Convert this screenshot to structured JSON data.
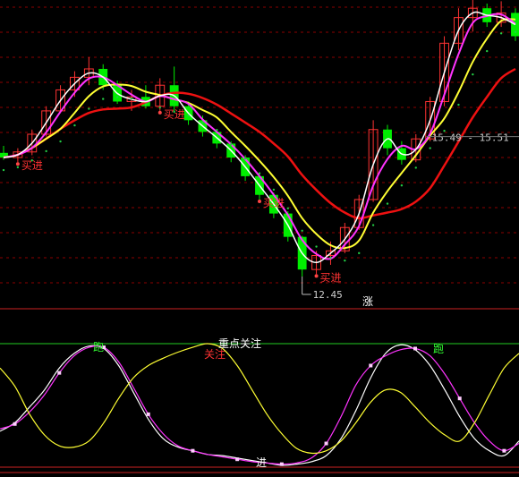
{
  "chart_data": [
    {
      "type": "candlestick",
      "price_markers": {
        "low_label": "12.45",
        "high_label": "15.49 - 15.51"
      },
      "signals": [
        {
          "text": "买进",
          "index": 1
        },
        {
          "text": "买进",
          "index": 11
        },
        {
          "text": "买进",
          "index": 18
        },
        {
          "text": "买进",
          "index": 22
        }
      ],
      "series_colors": {
        "up": "#ff3333",
        "down": "#00ee00",
        "ma_fast": "#ffffff",
        "ma_mid": "#ff33ff",
        "ma_slow": "#ffff33",
        "ma_long": "#ee1111",
        "dots": "#22cc44",
        "rect": "#33ddff"
      },
      "candles": [
        {
          "o": 15.1,
          "h": 15.25,
          "l": 14.95,
          "c": 15.0
        },
        {
          "o": 15.0,
          "h": 15.2,
          "l": 14.9,
          "c": 15.12
        },
        {
          "o": 15.12,
          "h": 15.6,
          "l": 15.05,
          "c": 15.5
        },
        {
          "o": 15.5,
          "h": 16.1,
          "l": 15.45,
          "c": 16.0
        },
        {
          "o": 16.0,
          "h": 16.55,
          "l": 15.95,
          "c": 16.45
        },
        {
          "o": 16.45,
          "h": 16.85,
          "l": 16.3,
          "c": 16.72
        },
        {
          "o": 16.72,
          "h": 17.15,
          "l": 16.55,
          "c": 16.9
        },
        {
          "o": 16.9,
          "h": 17.0,
          "l": 16.45,
          "c": 16.55
        },
        {
          "o": 16.55,
          "h": 16.65,
          "l": 16.15,
          "c": 16.2
        },
        {
          "o": 16.2,
          "h": 16.45,
          "l": 16.0,
          "c": 16.3
        },
        {
          "o": 16.3,
          "h": 16.55,
          "l": 16.05,
          "c": 16.1
        },
        {
          "o": 16.1,
          "h": 16.7,
          "l": 16.0,
          "c": 16.55
        },
        {
          "o": 16.55,
          "h": 16.95,
          "l": 16.0,
          "c": 16.1
        },
        {
          "o": 16.1,
          "h": 16.2,
          "l": 15.7,
          "c": 15.8
        },
        {
          "o": 15.8,
          "h": 15.9,
          "l": 15.45,
          "c": 15.55
        },
        {
          "o": 15.55,
          "h": 15.6,
          "l": 15.2,
          "c": 15.3
        },
        {
          "o": 15.3,
          "h": 15.35,
          "l": 14.9,
          "c": 15.0
        },
        {
          "o": 15.0,
          "h": 15.05,
          "l": 14.5,
          "c": 14.6
        },
        {
          "o": 14.6,
          "h": 14.65,
          "l": 14.1,
          "c": 14.2
        },
        {
          "o": 14.2,
          "h": 14.25,
          "l": 13.7,
          "c": 13.8
        },
        {
          "o": 13.8,
          "h": 13.85,
          "l": 13.2,
          "c": 13.3
        },
        {
          "o": 13.3,
          "h": 13.32,
          "l": 12.45,
          "c": 12.6
        },
        {
          "o": 12.6,
          "h": 13.0,
          "l": 12.5,
          "c": 12.9
        },
        {
          "o": 12.9,
          "h": 13.2,
          "l": 12.7,
          "c": 13.0
        },
        {
          "o": 13.0,
          "h": 13.6,
          "l": 12.95,
          "c": 13.5
        },
        {
          "o": 13.5,
          "h": 14.2,
          "l": 13.45,
          "c": 14.1
        },
        {
          "o": 14.1,
          "h": 15.8,
          "l": 14.05,
          "c": 15.6
        },
        {
          "o": 15.6,
          "h": 15.7,
          "l": 15.05,
          "c": 15.2
        },
        {
          "o": 15.2,
          "h": 15.35,
          "l": 14.85,
          "c": 14.95
        },
        {
          "o": 14.95,
          "h": 15.5,
          "l": 14.9,
          "c": 15.4
        },
        {
          "o": 15.4,
          "h": 16.3,
          "l": 15.35,
          "c": 16.2
        },
        {
          "o": 16.2,
          "h": 17.6,
          "l": 16.1,
          "c": 17.45
        },
        {
          "o": 17.45,
          "h": 18.2,
          "l": 17.3,
          "c": 18.0
        },
        {
          "o": 18.0,
          "h": 18.4,
          "l": 17.7,
          "c": 18.2
        },
        {
          "o": 18.2,
          "h": 18.3,
          "l": 17.8,
          "c": 17.9
        },
        {
          "o": 17.9,
          "h": 18.35,
          "l": 17.8,
          "c": 18.1
        },
        {
          "o": 18.1,
          "h": 18.2,
          "l": 17.5,
          "c": 17.6
        }
      ]
    },
    {
      "type": "line",
      "x_count": 36,
      "series": [
        {
          "color": "#ffffff",
          "values": [
            28,
            35,
            48,
            62,
            80,
            92,
            98,
            96,
            82,
            60,
            38,
            22,
            15,
            12,
            9,
            8,
            6,
            4,
            2,
            0,
            1,
            3,
            8,
            22,
            45,
            72,
            92,
            99,
            95,
            82,
            62,
            40,
            22,
            12,
            8,
            20
          ]
        },
        {
          "color": "#ff33ff",
          "values": [
            30,
            34,
            44,
            58,
            76,
            90,
            97,
            97,
            85,
            64,
            42,
            26,
            16,
            12,
            9,
            7,
            5,
            3,
            2,
            1,
            2,
            6,
            18,
            40,
            66,
            82,
            90,
            95,
            96,
            90,
            75,
            55,
            35,
            20,
            12,
            18
          ]
        },
        {
          "color": "#ffff33",
          "values": [
            80,
            65,
            42,
            25,
            16,
            15,
            20,
            35,
            55,
            72,
            82,
            88,
            93,
            97,
            100,
            96,
            82,
            62,
            42,
            26,
            14,
            10,
            12,
            20,
            35,
            52,
            62,
            60,
            48,
            35,
            25,
            20,
            35,
            58,
            80,
            92
          ]
        }
      ],
      "annotations": [
        {
          "text": "重点关注",
          "color": "#ffffff"
        },
        {
          "text": "关注",
          "color": "#ff3333"
        },
        {
          "text": "跑",
          "color": "#33ff33"
        },
        {
          "text": "跑",
          "color": "#33ff33"
        },
        {
          "text": "进",
          "color": "#ffffff"
        }
      ],
      "guide_colors": {
        "top": "#22cc22",
        "bottom": "#cc2222",
        "divider": "#cc2222"
      }
    }
  ],
  "mid_label": {
    "text": "涨",
    "color": "#ffffff"
  }
}
